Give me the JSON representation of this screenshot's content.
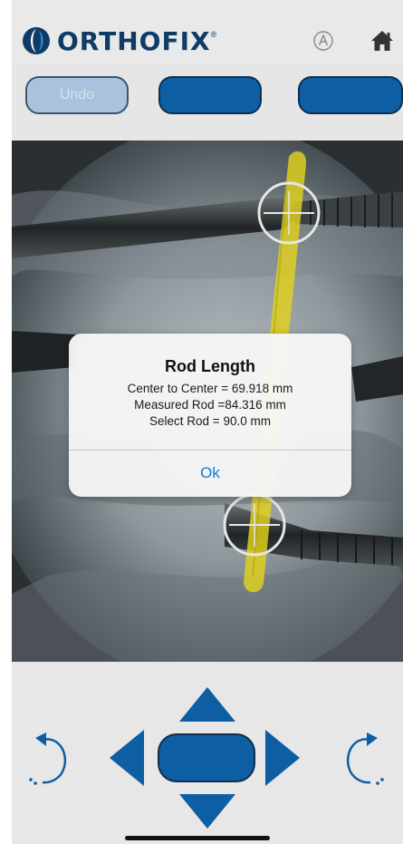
{
  "header": {
    "brand": "ORTHOFIX",
    "brand_mark": "®",
    "auto_icon": "auto-a-icon",
    "home_icon": "home-icon"
  },
  "toolbar": {
    "undo_label": "Undo",
    "button2_label": "",
    "button3_label": ""
  },
  "dialog": {
    "title": "Rod Length",
    "center_to_center": "Center to Center = 69.918 mm",
    "measured_rod": "Measured Rod =84.316 mm",
    "select_rod": "Select Rod = 90.0 mm",
    "ok_label": "Ok"
  },
  "controls": {
    "rotate_left_icon": "rotate-ccw-icon",
    "rotate_right_icon": "rotate-cw-icon",
    "up_icon": "arrow-up-icon",
    "down_icon": "arrow-down-icon",
    "left_icon": "arrow-left-icon",
    "right_icon": "arrow-right-icon",
    "center_label": ""
  },
  "colors": {
    "brand": "#0e3c66",
    "button_fill": "#0e5ea3",
    "button_disabled": "#a9c3dd",
    "rod_overlay": "#e2d21c",
    "ok_link": "#1877d2"
  }
}
